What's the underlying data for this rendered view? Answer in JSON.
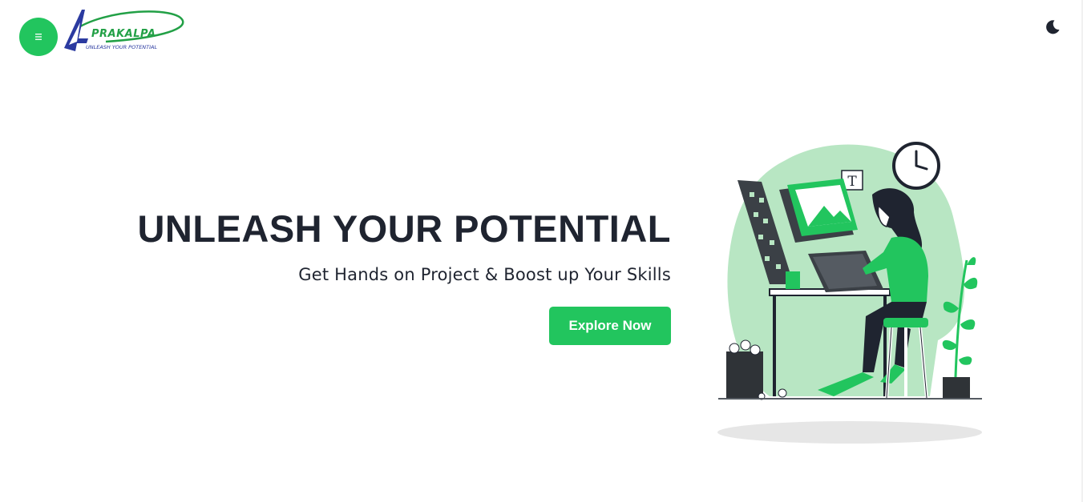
{
  "header": {
    "menu_icon": "hamburger-menu-icon",
    "logo": {
      "wordmark": "PRAKALPA",
      "tagline": "UNLEASH YOUR POTENTIAL"
    },
    "theme_toggle_icon": "moon-icon"
  },
  "hero": {
    "title": "UNLEASH YOUR POTENTIAL",
    "subtitle": "Get Hands on Project & Boost up Your Skills",
    "cta_label": "Explore Now",
    "illustration": "designer-at-drawing-tablet-illustration"
  },
  "colors": {
    "accent": "#22c55e",
    "text": "#1f2430",
    "logo_blue": "#2b3aa0",
    "illustration_soft_green": "#b8e6c3"
  }
}
